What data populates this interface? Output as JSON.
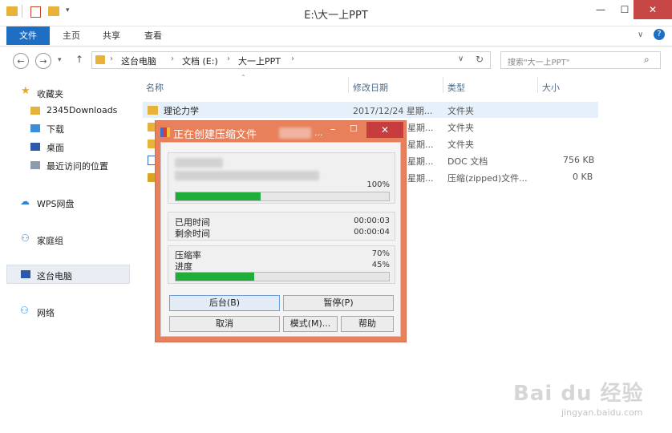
{
  "window": {
    "title": "E:\\大一上PPT",
    "minimize": "—",
    "maximize": "☐",
    "close": "✕"
  },
  "ribbon": {
    "tabs": [
      "文件",
      "主页",
      "共享",
      "查看"
    ]
  },
  "address": {
    "crumbs": [
      "这台电脑",
      "文档 (E:)",
      "大一上PPT"
    ],
    "search_placeholder": "搜索\"大一上PPT\""
  },
  "sidebar": {
    "favorites": "收藏夹",
    "items": [
      "2345Downloads",
      "下载",
      "桌面",
      "最近访问的位置"
    ],
    "wps": "WPS网盘",
    "homegroup": "家庭组",
    "thispc": "这台电脑",
    "network": "网络"
  },
  "columns": {
    "name": "名称",
    "date": "修改日期",
    "type": "类型",
    "size": "大小"
  },
  "files": [
    {
      "name": "理论力学",
      "date": "2017/12/24 星期...",
      "type": "文件夹",
      "size": ""
    },
    {
      "name": "",
      "date": "星期...",
      "type": "文件夹",
      "size": ""
    },
    {
      "name": "",
      "date": "星期...",
      "type": "文件夹",
      "size": ""
    },
    {
      "name": "",
      "date": "星期...",
      "type": "DOC 文档",
      "size": "756 KB"
    },
    {
      "name": "",
      "date": "星期...",
      "type": "压缩(zipped)文件...",
      "size": "0 KB"
    }
  ],
  "dialog": {
    "title": "正在创建压缩文件",
    "title_suffix": "...",
    "file_percent": "100%",
    "file_progress": 0.4,
    "elapsed_label": "已用时间",
    "elapsed_value": "00:00:03",
    "remaining_label": "剩余时间",
    "remaining_value": "00:00:04",
    "ratio_label": "压缩率",
    "ratio_value": "70%",
    "progress_label": "进度",
    "progress_value": "45%",
    "progress": 0.37,
    "buttons": {
      "background": "后台(B)",
      "pause": "暂停(P)",
      "cancel": "取消",
      "mode": "模式(M)...",
      "help": "帮助"
    }
  },
  "watermark": {
    "brand": "Bai du 经验",
    "url": "jingyan.baidu.com"
  },
  "colors": {
    "accent": "#1e6fc3",
    "dialog_frame": "#e8805c",
    "progress": "#1fae3a"
  }
}
